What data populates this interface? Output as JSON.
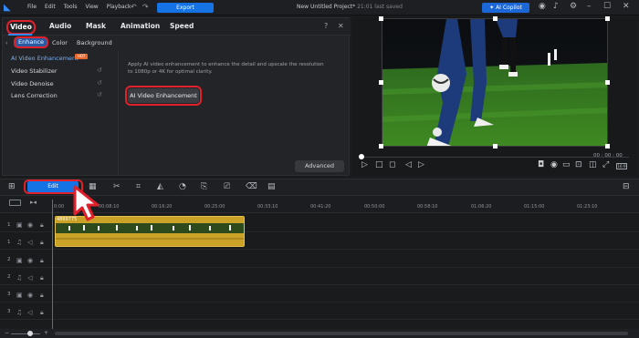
{
  "titlebar": {
    "menu": [
      "File",
      "Edit",
      "Tools",
      "View",
      "Playback"
    ],
    "export_label": "Export",
    "project_title": "New Untitled Project*",
    "project_status": "21:01 last saved",
    "copilot_label": "AI Copilot"
  },
  "tabs": [
    "Video",
    "Audio",
    "Mask",
    "Animation",
    "Speed"
  ],
  "subtabs": [
    "Enhance",
    "Color",
    "Background"
  ],
  "features": [
    {
      "label": "AI Video Enhancement",
      "badge": "HOT"
    },
    {
      "label": "Video Stabilizer"
    },
    {
      "label": "Video Denoise"
    },
    {
      "label": "Lens Correction"
    }
  ],
  "description": "Apply AI video enhancement to enhance the detail and upscale the resolution to 1080p or 4K for optimal clarity.",
  "ai_button": "AI Video Enhancement",
  "advanced_label": "Advanced",
  "preview": {
    "time": "00 : 00 : 00"
  },
  "edit_label": "Edit",
  "ruler": [
    "0:00",
    "00:08:10",
    "00:16:20",
    "00:25:00",
    "00:33:10",
    "00:41:20",
    "00:50:00",
    "00:58:10",
    "01:06:20",
    "01:15:00",
    "01:23:10"
  ],
  "tracks": [
    "1",
    "1",
    "2",
    "2",
    "3",
    "3"
  ],
  "clip_name": "4869775",
  "colors": {
    "accent": "#1673e6",
    "highlight": "#e0202a",
    "clip": "#c9a227"
  }
}
